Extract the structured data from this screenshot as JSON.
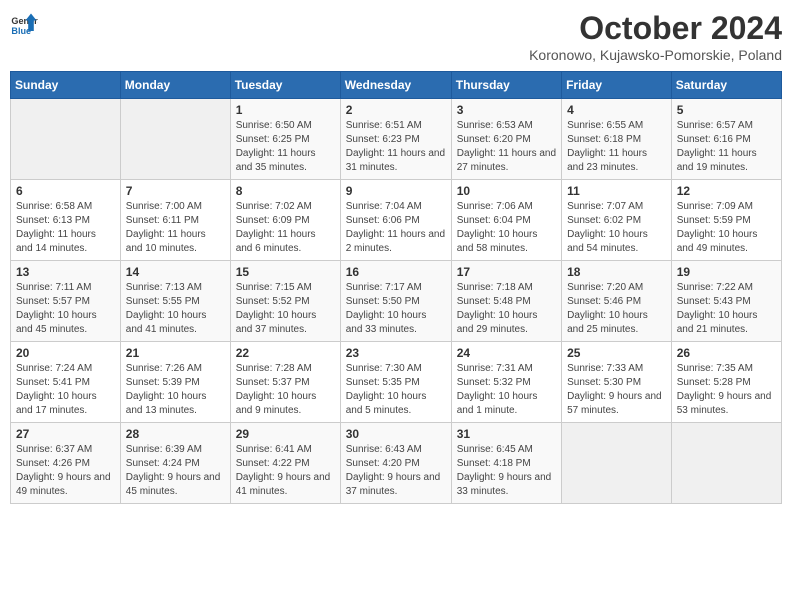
{
  "header": {
    "logo_line1": "General",
    "logo_line2": "Blue",
    "month": "October 2024",
    "location": "Koronowo, Kujawsko-Pomorskie, Poland"
  },
  "days_of_week": [
    "Sunday",
    "Monday",
    "Tuesday",
    "Wednesday",
    "Thursday",
    "Friday",
    "Saturday"
  ],
  "weeks": [
    [
      {
        "day": "",
        "sunrise": "",
        "sunset": "",
        "daylight": ""
      },
      {
        "day": "",
        "sunrise": "",
        "sunset": "",
        "daylight": ""
      },
      {
        "day": "1",
        "sunrise": "Sunrise: 6:50 AM",
        "sunset": "Sunset: 6:25 PM",
        "daylight": "Daylight: 11 hours and 35 minutes."
      },
      {
        "day": "2",
        "sunrise": "Sunrise: 6:51 AM",
        "sunset": "Sunset: 6:23 PM",
        "daylight": "Daylight: 11 hours and 31 minutes."
      },
      {
        "day": "3",
        "sunrise": "Sunrise: 6:53 AM",
        "sunset": "Sunset: 6:20 PM",
        "daylight": "Daylight: 11 hours and 27 minutes."
      },
      {
        "day": "4",
        "sunrise": "Sunrise: 6:55 AM",
        "sunset": "Sunset: 6:18 PM",
        "daylight": "Daylight: 11 hours and 23 minutes."
      },
      {
        "day": "5",
        "sunrise": "Sunrise: 6:57 AM",
        "sunset": "Sunset: 6:16 PM",
        "daylight": "Daylight: 11 hours and 19 minutes."
      }
    ],
    [
      {
        "day": "6",
        "sunrise": "Sunrise: 6:58 AM",
        "sunset": "Sunset: 6:13 PM",
        "daylight": "Daylight: 11 hours and 14 minutes."
      },
      {
        "day": "7",
        "sunrise": "Sunrise: 7:00 AM",
        "sunset": "Sunset: 6:11 PM",
        "daylight": "Daylight: 11 hours and 10 minutes."
      },
      {
        "day": "8",
        "sunrise": "Sunrise: 7:02 AM",
        "sunset": "Sunset: 6:09 PM",
        "daylight": "Daylight: 11 hours and 6 minutes."
      },
      {
        "day": "9",
        "sunrise": "Sunrise: 7:04 AM",
        "sunset": "Sunset: 6:06 PM",
        "daylight": "Daylight: 11 hours and 2 minutes."
      },
      {
        "day": "10",
        "sunrise": "Sunrise: 7:06 AM",
        "sunset": "Sunset: 6:04 PM",
        "daylight": "Daylight: 10 hours and 58 minutes."
      },
      {
        "day": "11",
        "sunrise": "Sunrise: 7:07 AM",
        "sunset": "Sunset: 6:02 PM",
        "daylight": "Daylight: 10 hours and 54 minutes."
      },
      {
        "day": "12",
        "sunrise": "Sunrise: 7:09 AM",
        "sunset": "Sunset: 5:59 PM",
        "daylight": "Daylight: 10 hours and 49 minutes."
      }
    ],
    [
      {
        "day": "13",
        "sunrise": "Sunrise: 7:11 AM",
        "sunset": "Sunset: 5:57 PM",
        "daylight": "Daylight: 10 hours and 45 minutes."
      },
      {
        "day": "14",
        "sunrise": "Sunrise: 7:13 AM",
        "sunset": "Sunset: 5:55 PM",
        "daylight": "Daylight: 10 hours and 41 minutes."
      },
      {
        "day": "15",
        "sunrise": "Sunrise: 7:15 AM",
        "sunset": "Sunset: 5:52 PM",
        "daylight": "Daylight: 10 hours and 37 minutes."
      },
      {
        "day": "16",
        "sunrise": "Sunrise: 7:17 AM",
        "sunset": "Sunset: 5:50 PM",
        "daylight": "Daylight: 10 hours and 33 minutes."
      },
      {
        "day": "17",
        "sunrise": "Sunrise: 7:18 AM",
        "sunset": "Sunset: 5:48 PM",
        "daylight": "Daylight: 10 hours and 29 minutes."
      },
      {
        "day": "18",
        "sunrise": "Sunrise: 7:20 AM",
        "sunset": "Sunset: 5:46 PM",
        "daylight": "Daylight: 10 hours and 25 minutes."
      },
      {
        "day": "19",
        "sunrise": "Sunrise: 7:22 AM",
        "sunset": "Sunset: 5:43 PM",
        "daylight": "Daylight: 10 hours and 21 minutes."
      }
    ],
    [
      {
        "day": "20",
        "sunrise": "Sunrise: 7:24 AM",
        "sunset": "Sunset: 5:41 PM",
        "daylight": "Daylight: 10 hours and 17 minutes."
      },
      {
        "day": "21",
        "sunrise": "Sunrise: 7:26 AM",
        "sunset": "Sunset: 5:39 PM",
        "daylight": "Daylight: 10 hours and 13 minutes."
      },
      {
        "day": "22",
        "sunrise": "Sunrise: 7:28 AM",
        "sunset": "Sunset: 5:37 PM",
        "daylight": "Daylight: 10 hours and 9 minutes."
      },
      {
        "day": "23",
        "sunrise": "Sunrise: 7:30 AM",
        "sunset": "Sunset: 5:35 PM",
        "daylight": "Daylight: 10 hours and 5 minutes."
      },
      {
        "day": "24",
        "sunrise": "Sunrise: 7:31 AM",
        "sunset": "Sunset: 5:32 PM",
        "daylight": "Daylight: 10 hours and 1 minute."
      },
      {
        "day": "25",
        "sunrise": "Sunrise: 7:33 AM",
        "sunset": "Sunset: 5:30 PM",
        "daylight": "Daylight: 9 hours and 57 minutes."
      },
      {
        "day": "26",
        "sunrise": "Sunrise: 7:35 AM",
        "sunset": "Sunset: 5:28 PM",
        "daylight": "Daylight: 9 hours and 53 minutes."
      }
    ],
    [
      {
        "day": "27",
        "sunrise": "Sunrise: 6:37 AM",
        "sunset": "Sunset: 4:26 PM",
        "daylight": "Daylight: 9 hours and 49 minutes."
      },
      {
        "day": "28",
        "sunrise": "Sunrise: 6:39 AM",
        "sunset": "Sunset: 4:24 PM",
        "daylight": "Daylight: 9 hours and 45 minutes."
      },
      {
        "day": "29",
        "sunrise": "Sunrise: 6:41 AM",
        "sunset": "Sunset: 4:22 PM",
        "daylight": "Daylight: 9 hours and 41 minutes."
      },
      {
        "day": "30",
        "sunrise": "Sunrise: 6:43 AM",
        "sunset": "Sunset: 4:20 PM",
        "daylight": "Daylight: 9 hours and 37 minutes."
      },
      {
        "day": "31",
        "sunrise": "Sunrise: 6:45 AM",
        "sunset": "Sunset: 4:18 PM",
        "daylight": "Daylight: 9 hours and 33 minutes."
      },
      {
        "day": "",
        "sunrise": "",
        "sunset": "",
        "daylight": ""
      },
      {
        "day": "",
        "sunrise": "",
        "sunset": "",
        "daylight": ""
      }
    ]
  ]
}
